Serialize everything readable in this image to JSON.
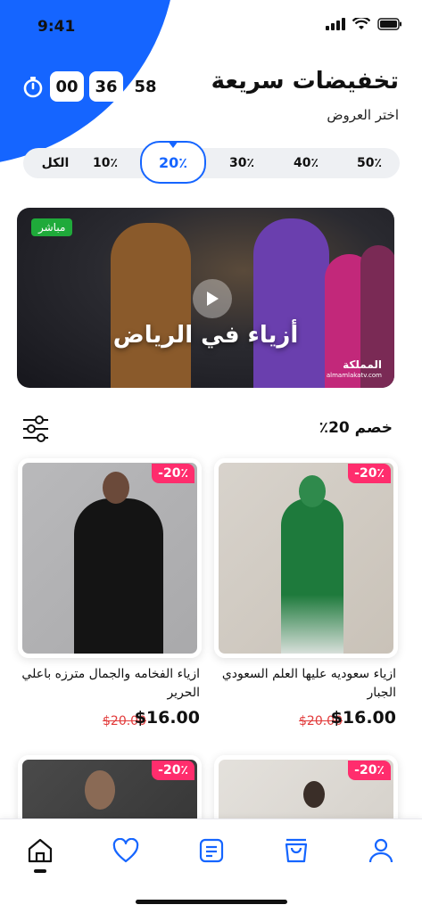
{
  "status": {
    "time": "9:41"
  },
  "header": {
    "title": "تخفيضات سريعة",
    "subtitle": "اختر العروض",
    "timer": {
      "hours": "00",
      "minutes": "36",
      "seconds": "58"
    }
  },
  "tabs": [
    {
      "label": "الكل"
    },
    {
      "label": "10٪"
    },
    {
      "label": "20٪",
      "active": true
    },
    {
      "label": "30٪"
    },
    {
      "label": "40٪"
    },
    {
      "label": "50٪"
    }
  ],
  "banner": {
    "live_label": "مباشر",
    "title": "أزياء في الرياض",
    "brand": "المملكة",
    "brand_url": "almamlakatv.com"
  },
  "section": {
    "title": "خصم 20٪"
  },
  "products": [
    {
      "discount": "-20٪",
      "name": "ازياء سعوديه عليها العلم السعودي الجبار",
      "old_price": "$20.00",
      "price": "$16.00"
    },
    {
      "discount": "-20٪",
      "name": "ازياء الفخامه والجمال مترزه باعلي الحرير",
      "old_price": "$20.00",
      "price": "$16.00"
    },
    {
      "discount": "-20٪"
    },
    {
      "discount": "-20٪"
    }
  ],
  "colors": {
    "accent": "#1565ff",
    "discount": "#ff2d6d",
    "live": "#1faa3a",
    "old_price": "#e23b3b"
  },
  "nav": [
    {
      "icon": "home-icon",
      "active": true
    },
    {
      "icon": "heart-icon"
    },
    {
      "icon": "orders-icon"
    },
    {
      "icon": "bag-icon"
    },
    {
      "icon": "profile-icon"
    }
  ]
}
